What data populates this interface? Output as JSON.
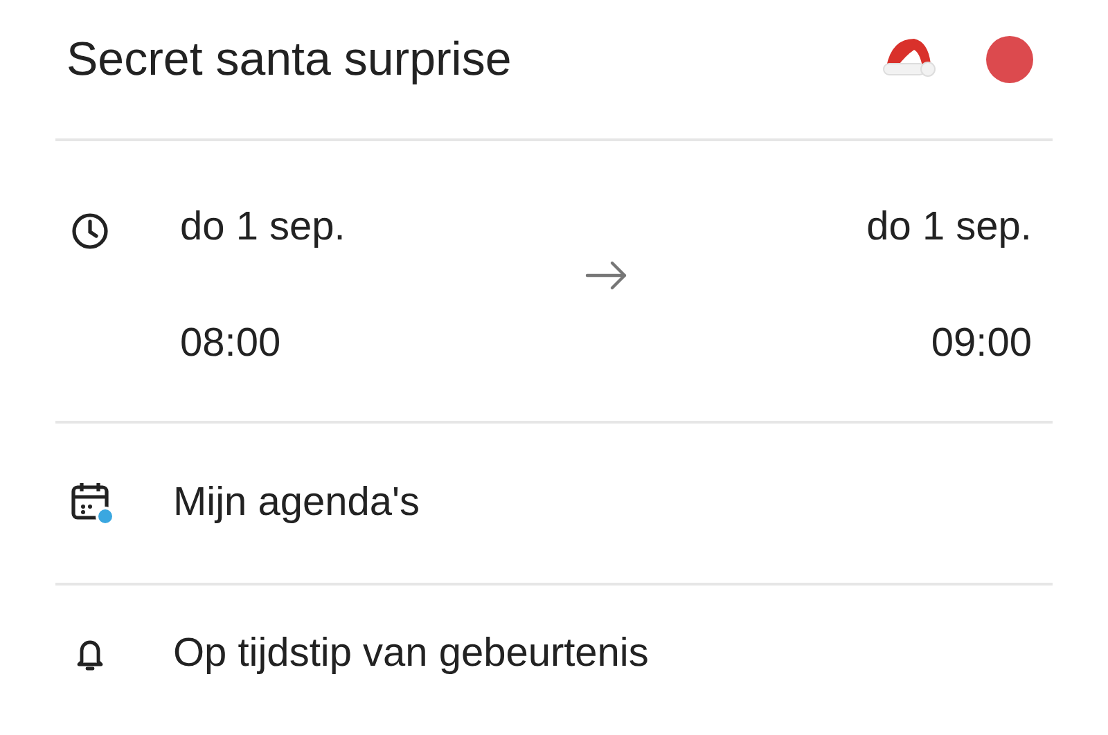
{
  "event": {
    "title": "Secret santa surprise",
    "color": "#dc4a4e"
  },
  "start": {
    "date": "do 1 sep.",
    "time": "08:00"
  },
  "end": {
    "date": "do 1 sep.",
    "time": "09:00"
  },
  "calendar": {
    "name": "Mijn agenda's",
    "color": "#3aa7e0"
  },
  "reminder": {
    "label": "Op tijdstip van gebeurtenis"
  }
}
